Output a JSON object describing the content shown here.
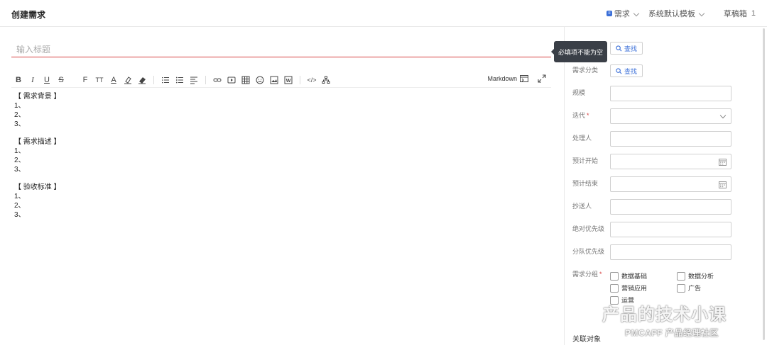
{
  "header": {
    "title": "创建需求",
    "type_label": "需求",
    "template_label": "系统默认模板",
    "draft_label": "草稿箱",
    "draft_count": "1"
  },
  "editor": {
    "title_placeholder": "输入标题",
    "title_value": "",
    "markdown_label": "Markdown",
    "content": [
      {
        "heading": "【 需求背景 】",
        "items": [
          "1、",
          "2、",
          "3、"
        ]
      },
      {
        "heading": "【 需求描述 】",
        "items": [
          "1、",
          "2、",
          "3、"
        ]
      },
      {
        "heading": "【 验收标准 】",
        "items": [
          "1、",
          "2、",
          "3、"
        ]
      }
    ]
  },
  "tooltip": {
    "text": "必填项不能为空"
  },
  "panel": {
    "find_label": "查找",
    "fields": {
      "category": "需求分类",
      "scale": "规模",
      "iteration": "迭代",
      "assignee": "处理人",
      "start": "预计开始",
      "end": "预计结束",
      "cc": "抄送人",
      "abs_priority": "绝对优先级",
      "team_priority": "分队优先级",
      "groups": "需求分组"
    },
    "required_mark": "*",
    "group_options": [
      "数据基础",
      "数据分析",
      "营销应用",
      "广告",
      "运营"
    ],
    "related_label": "关联对象"
  },
  "watermark": {
    "line1": "产品的技术小课",
    "line2": "PMCAFF 产品经理社区"
  }
}
